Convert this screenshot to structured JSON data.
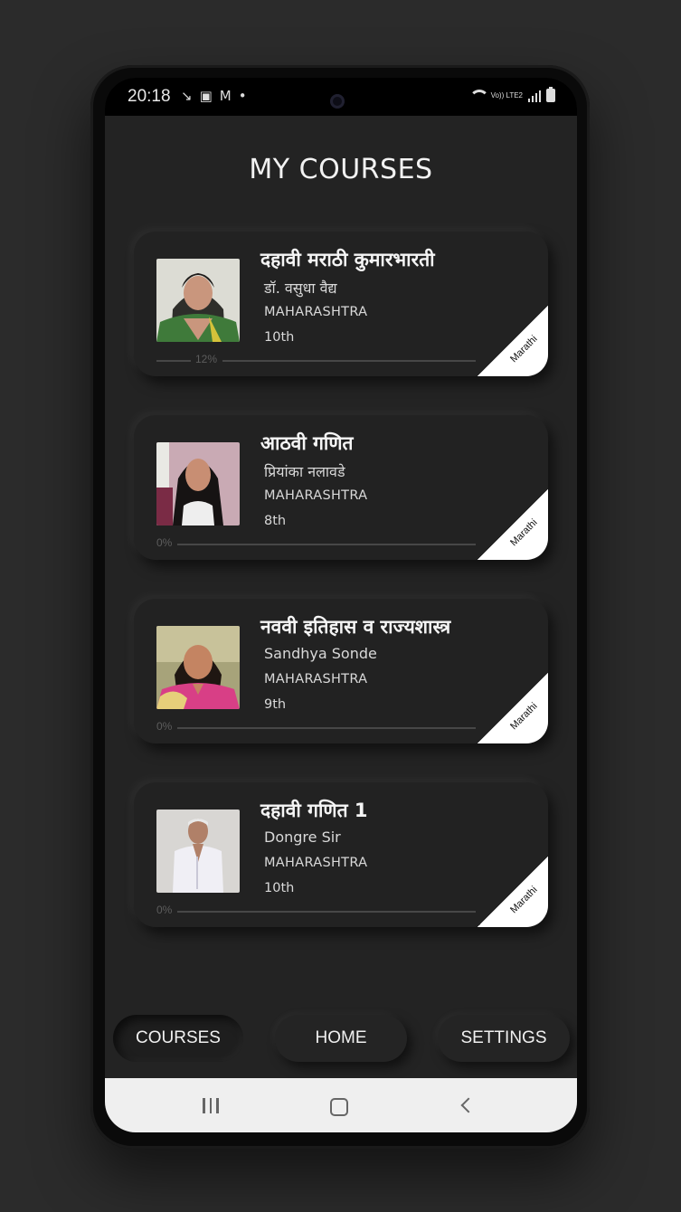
{
  "status_bar": {
    "time": "20:18",
    "left_icons": [
      "missed-call-icon",
      "gallery-icon",
      "gmail-icon",
      "dot-icon"
    ],
    "network_label": "Vo)) LTE2"
  },
  "page": {
    "title": "MY COURSES"
  },
  "courses": [
    {
      "title": "दहावी मराठी कुमारभारती",
      "teacher": "डॉ. वसुधा वैद्य",
      "state": "MAHARASHTRA",
      "grade": "10th",
      "progress_label": "12%",
      "progress": 0.12,
      "language": "Marathi"
    },
    {
      "title": "आठवी गणित",
      "teacher": "प्रियांका नलावडे",
      "state": "MAHARASHTRA",
      "grade": "8th",
      "progress_label": "0%",
      "progress": 0,
      "language": "Marathi"
    },
    {
      "title": "नववी इतिहास व राज्यशास्त्र",
      "teacher": "Sandhya Sonde",
      "state": "MAHARASHTRA",
      "grade": "9th",
      "progress_label": "0%",
      "progress": 0,
      "language": "Marathi"
    },
    {
      "title": "दहावी गणित 1",
      "teacher": "Dongre Sir",
      "state": "MAHARASHTRA",
      "grade": "10th",
      "progress_label": "0%",
      "progress": 0,
      "language": "Marathi"
    }
  ],
  "bottom_nav": {
    "courses": "COURSES",
    "home": "HOME",
    "settings": "SETTINGS",
    "active": "courses"
  },
  "colors": {
    "background": "#232323",
    "card": "#222222",
    "ribbon": "#ffffff",
    "text": "#f5f5f5"
  }
}
